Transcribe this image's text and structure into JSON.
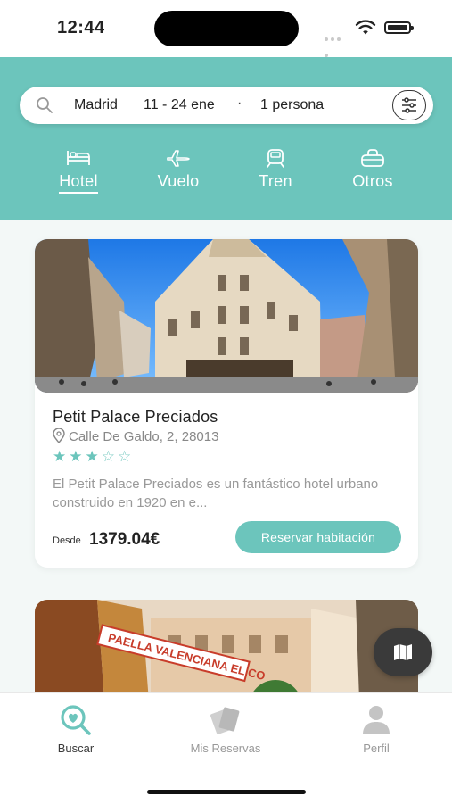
{
  "status": {
    "time": "12:44"
  },
  "search": {
    "city": "Madrid",
    "dates": "11 - 24 ene",
    "separator": "·",
    "guests": "1 persona"
  },
  "tabs": [
    {
      "label": "Hotel",
      "icon": "bed-icon",
      "active": true
    },
    {
      "label": "Vuelo",
      "icon": "plane-icon"
    },
    {
      "label": "Tren",
      "icon": "train-icon"
    },
    {
      "label": "Otros",
      "icon": "bag-icon"
    }
  ],
  "hotel": {
    "name": "Petit Palace Preciados",
    "address": "Calle De Galdo, 2, 28013",
    "rating": 3,
    "max_rating": 5,
    "stars_text": "★★★☆☆",
    "description": "El  Petit Palace Preciados es un fantástico hotel urbano construido en 1920 en e...",
    "from_label": "Desde",
    "price": "1379.04€",
    "button": "Reservar habitación"
  },
  "second_card": {
    "sign_text": "PAELLA VALENCIANA EL CO"
  },
  "nav": [
    {
      "label": "Buscar",
      "icon": "search-heart-icon",
      "active": true
    },
    {
      "label": "Mis Reservas",
      "icon": "tickets-icon"
    },
    {
      "label": "Perfil",
      "icon": "person-icon"
    }
  ],
  "colors": {
    "accent": "#6cc5bc",
    "fab": "#3a3a3a"
  }
}
